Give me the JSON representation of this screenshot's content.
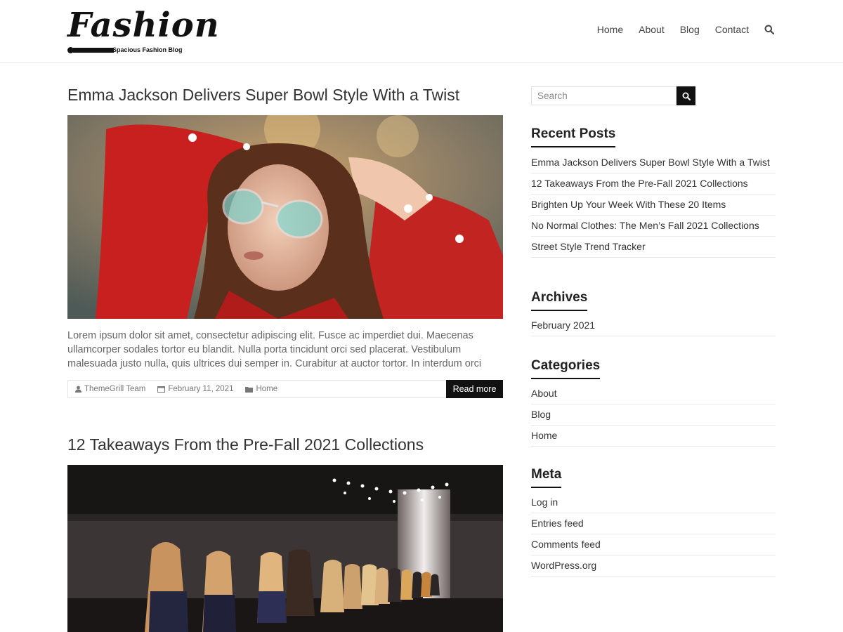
{
  "header": {
    "logo_title": "Fashion",
    "logo_tagline": "Spacious Fashion Blog",
    "nav": [
      "Home",
      "About",
      "Blog",
      "Contact"
    ],
    "search_icon": "search-icon"
  },
  "posts": [
    {
      "title": "Emma Jackson Delivers Super Bowl Style With a Twist",
      "image": "woman-red-jacket-glasses-photo",
      "excerpt": "Lorem ipsum dolor sit amet, consectetur adipiscing elit. Fusce ac imperdiet dui. Maecenas ullamcorper sodales tortor eu blandit. Nulla porta tincidunt orci sed placerat. Vestibulum malesuada justo nulla, quis ultrices dui semper in. Curabitur at auctor tortor. In interdum orci",
      "author": "ThemeGrill Team",
      "date": "February 11, 2021",
      "category": "Home",
      "read_more": "Read more"
    },
    {
      "title": "12 Takeaways From the Pre-Fall 2021 Collections",
      "image": "runway-fashion-show-photo"
    }
  ],
  "sidebar": {
    "search_placeholder": "Search",
    "recent_posts": {
      "title": "Recent Posts",
      "items": [
        "Emma Jackson Delivers Super Bowl Style With a Twist",
        "12 Takeaways From the Pre-Fall 2021 Collections",
        "Brighten Up Your Week With These 20 Items",
        "No Normal Clothes: The Men’s Fall 2021 Collections",
        "Street Style Trend Tracker"
      ]
    },
    "archives": {
      "title": "Archives",
      "items": [
        "February 2021"
      ]
    },
    "categories": {
      "title": "Categories",
      "items": [
        "About",
        "Blog",
        "Home"
      ]
    },
    "meta": {
      "title": "Meta",
      "items": [
        "Log in",
        "Entries feed",
        "Comments feed",
        "WordPress.org"
      ]
    }
  },
  "colors": {
    "accent": "#111111",
    "text": "#444444",
    "border": "#e8e8e8"
  }
}
